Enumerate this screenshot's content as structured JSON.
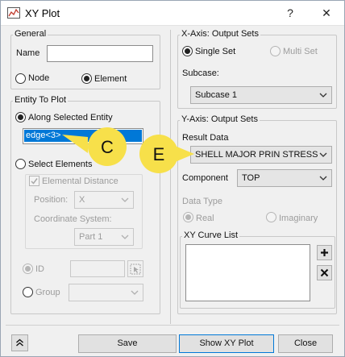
{
  "window": {
    "title": "XY Plot",
    "help_label": "?",
    "close_label": "✕"
  },
  "left": {
    "general": {
      "title": "General",
      "name_label": "Name",
      "name_value": ""
    },
    "type": {
      "node_label": "Node",
      "element_label": "Element",
      "selected": "Element"
    },
    "entity": {
      "title": "Entity To Plot",
      "along_label": "Along Selected Entity",
      "selected_entity": "edge<3>",
      "select_elements_label": "Select Elements",
      "elemental_distance_label": "Elemental Distance",
      "position_label": "Position:",
      "position_value": "X",
      "coord_label": "Coordinate System:",
      "coord_value": "Part 1",
      "id_label": "ID",
      "id_value": "",
      "group_label": "Group",
      "group_value": ""
    }
  },
  "right": {
    "xaxis": {
      "title": "X-Axis: Output Sets",
      "single_label": "Single Set",
      "multi_label": "Multi Set",
      "subcase_label": "Subcase:",
      "subcase_value": "Subcase 1"
    },
    "yaxis": {
      "title": "Y-Axis: Output Sets",
      "result_label": "Result Data",
      "result_value": "SHELL MAJOR PRIN STRESS",
      "component_label": "Component",
      "component_value": "TOP",
      "datatype_label": "Data Type",
      "real_label": "Real",
      "imag_label": "Imaginary"
    },
    "curves": {
      "title": "XY Curve List",
      "add_label": "+",
      "remove_label": "✕"
    }
  },
  "footer": {
    "save_label": "Save",
    "show_label": "Show XY Plot",
    "close_label": "Close",
    "collapse_label": "⌃"
  },
  "callouts": {
    "c_label": "C",
    "e_label": "E",
    "color": "#f7e04a"
  }
}
